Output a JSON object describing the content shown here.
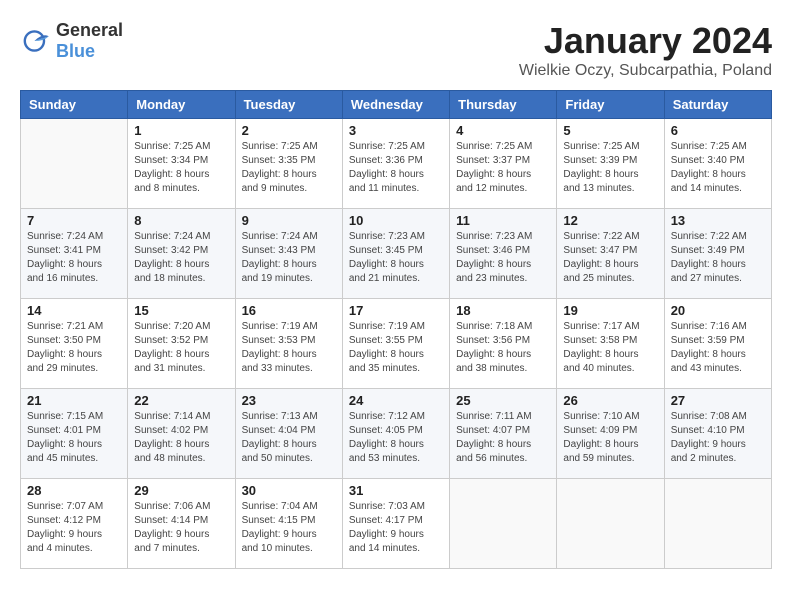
{
  "header": {
    "logo_general": "General",
    "logo_blue": "Blue",
    "month_title": "January 2024",
    "location": "Wielkie Oczy, Subcarpathia, Poland"
  },
  "days_of_week": [
    "Sunday",
    "Monday",
    "Tuesday",
    "Wednesday",
    "Thursday",
    "Friday",
    "Saturday"
  ],
  "weeks": [
    [
      {
        "day": "",
        "sunrise": "",
        "sunset": "",
        "daylight": ""
      },
      {
        "day": "1",
        "sunrise": "Sunrise: 7:25 AM",
        "sunset": "Sunset: 3:34 PM",
        "daylight": "Daylight: 8 hours and 8 minutes."
      },
      {
        "day": "2",
        "sunrise": "Sunrise: 7:25 AM",
        "sunset": "Sunset: 3:35 PM",
        "daylight": "Daylight: 8 hours and 9 minutes."
      },
      {
        "day": "3",
        "sunrise": "Sunrise: 7:25 AM",
        "sunset": "Sunset: 3:36 PM",
        "daylight": "Daylight: 8 hours and 11 minutes."
      },
      {
        "day": "4",
        "sunrise": "Sunrise: 7:25 AM",
        "sunset": "Sunset: 3:37 PM",
        "daylight": "Daylight: 8 hours and 12 minutes."
      },
      {
        "day": "5",
        "sunrise": "Sunrise: 7:25 AM",
        "sunset": "Sunset: 3:39 PM",
        "daylight": "Daylight: 8 hours and 13 minutes."
      },
      {
        "day": "6",
        "sunrise": "Sunrise: 7:25 AM",
        "sunset": "Sunset: 3:40 PM",
        "daylight": "Daylight: 8 hours and 14 minutes."
      }
    ],
    [
      {
        "day": "7",
        "sunrise": "Sunrise: 7:24 AM",
        "sunset": "Sunset: 3:41 PM",
        "daylight": "Daylight: 8 hours and 16 minutes."
      },
      {
        "day": "8",
        "sunrise": "Sunrise: 7:24 AM",
        "sunset": "Sunset: 3:42 PM",
        "daylight": "Daylight: 8 hours and 18 minutes."
      },
      {
        "day": "9",
        "sunrise": "Sunrise: 7:24 AM",
        "sunset": "Sunset: 3:43 PM",
        "daylight": "Daylight: 8 hours and 19 minutes."
      },
      {
        "day": "10",
        "sunrise": "Sunrise: 7:23 AM",
        "sunset": "Sunset: 3:45 PM",
        "daylight": "Daylight: 8 hours and 21 minutes."
      },
      {
        "day": "11",
        "sunrise": "Sunrise: 7:23 AM",
        "sunset": "Sunset: 3:46 PM",
        "daylight": "Daylight: 8 hours and 23 minutes."
      },
      {
        "day": "12",
        "sunrise": "Sunrise: 7:22 AM",
        "sunset": "Sunset: 3:47 PM",
        "daylight": "Daylight: 8 hours and 25 minutes."
      },
      {
        "day": "13",
        "sunrise": "Sunrise: 7:22 AM",
        "sunset": "Sunset: 3:49 PM",
        "daylight": "Daylight: 8 hours and 27 minutes."
      }
    ],
    [
      {
        "day": "14",
        "sunrise": "Sunrise: 7:21 AM",
        "sunset": "Sunset: 3:50 PM",
        "daylight": "Daylight: 8 hours and 29 minutes."
      },
      {
        "day": "15",
        "sunrise": "Sunrise: 7:20 AM",
        "sunset": "Sunset: 3:52 PM",
        "daylight": "Daylight: 8 hours and 31 minutes."
      },
      {
        "day": "16",
        "sunrise": "Sunrise: 7:19 AM",
        "sunset": "Sunset: 3:53 PM",
        "daylight": "Daylight: 8 hours and 33 minutes."
      },
      {
        "day": "17",
        "sunrise": "Sunrise: 7:19 AM",
        "sunset": "Sunset: 3:55 PM",
        "daylight": "Daylight: 8 hours and 35 minutes."
      },
      {
        "day": "18",
        "sunrise": "Sunrise: 7:18 AM",
        "sunset": "Sunset: 3:56 PM",
        "daylight": "Daylight: 8 hours and 38 minutes."
      },
      {
        "day": "19",
        "sunrise": "Sunrise: 7:17 AM",
        "sunset": "Sunset: 3:58 PM",
        "daylight": "Daylight: 8 hours and 40 minutes."
      },
      {
        "day": "20",
        "sunrise": "Sunrise: 7:16 AM",
        "sunset": "Sunset: 3:59 PM",
        "daylight": "Daylight: 8 hours and 43 minutes."
      }
    ],
    [
      {
        "day": "21",
        "sunrise": "Sunrise: 7:15 AM",
        "sunset": "Sunset: 4:01 PM",
        "daylight": "Daylight: 8 hours and 45 minutes."
      },
      {
        "day": "22",
        "sunrise": "Sunrise: 7:14 AM",
        "sunset": "Sunset: 4:02 PM",
        "daylight": "Daylight: 8 hours and 48 minutes."
      },
      {
        "day": "23",
        "sunrise": "Sunrise: 7:13 AM",
        "sunset": "Sunset: 4:04 PM",
        "daylight": "Daylight: 8 hours and 50 minutes."
      },
      {
        "day": "24",
        "sunrise": "Sunrise: 7:12 AM",
        "sunset": "Sunset: 4:05 PM",
        "daylight": "Daylight: 8 hours and 53 minutes."
      },
      {
        "day": "25",
        "sunrise": "Sunrise: 7:11 AM",
        "sunset": "Sunset: 4:07 PM",
        "daylight": "Daylight: 8 hours and 56 minutes."
      },
      {
        "day": "26",
        "sunrise": "Sunrise: 7:10 AM",
        "sunset": "Sunset: 4:09 PM",
        "daylight": "Daylight: 8 hours and 59 minutes."
      },
      {
        "day": "27",
        "sunrise": "Sunrise: 7:08 AM",
        "sunset": "Sunset: 4:10 PM",
        "daylight": "Daylight: 9 hours and 2 minutes."
      }
    ],
    [
      {
        "day": "28",
        "sunrise": "Sunrise: 7:07 AM",
        "sunset": "Sunset: 4:12 PM",
        "daylight": "Daylight: 9 hours and 4 minutes."
      },
      {
        "day": "29",
        "sunrise": "Sunrise: 7:06 AM",
        "sunset": "Sunset: 4:14 PM",
        "daylight": "Daylight: 9 hours and 7 minutes."
      },
      {
        "day": "30",
        "sunrise": "Sunrise: 7:04 AM",
        "sunset": "Sunset: 4:15 PM",
        "daylight": "Daylight: 9 hours and 10 minutes."
      },
      {
        "day": "31",
        "sunrise": "Sunrise: 7:03 AM",
        "sunset": "Sunset: 4:17 PM",
        "daylight": "Daylight: 9 hours and 14 minutes."
      },
      {
        "day": "",
        "sunrise": "",
        "sunset": "",
        "daylight": ""
      },
      {
        "day": "",
        "sunrise": "",
        "sunset": "",
        "daylight": ""
      },
      {
        "day": "",
        "sunrise": "",
        "sunset": "",
        "daylight": ""
      }
    ]
  ]
}
